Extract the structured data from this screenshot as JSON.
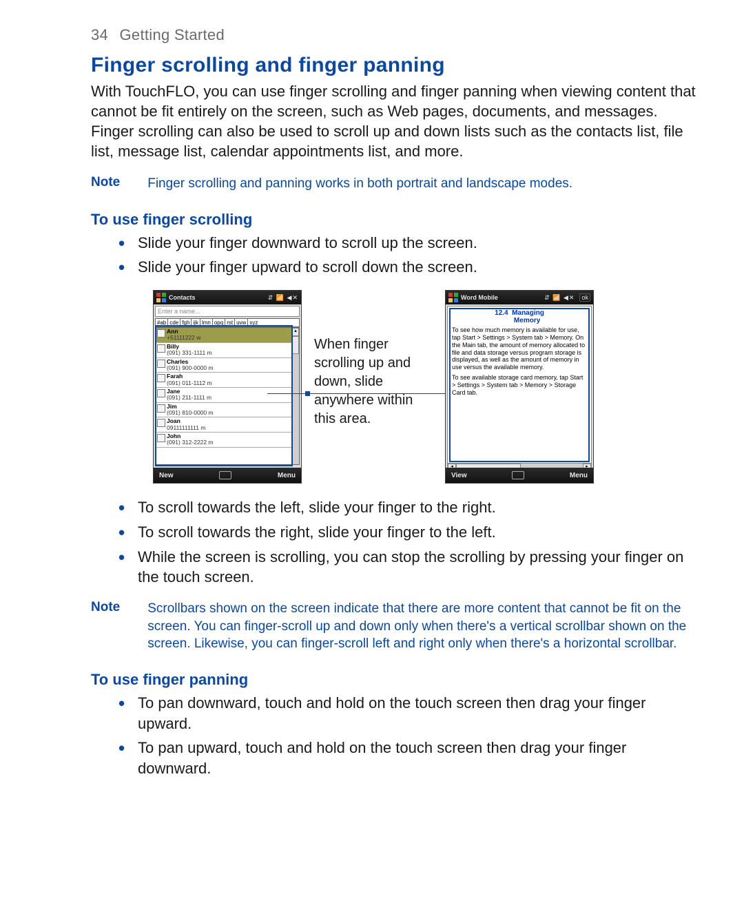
{
  "page": {
    "number": "34",
    "section": "Getting Started"
  },
  "heading1": "Finger scrolling and finger panning",
  "intro": "With TouchFLO, you can use finger scrolling and finger panning when viewing content that cannot be fit entirely on the screen, such as Web pages, documents, and messages. Finger scrolling can also be used to scroll up and down lists such as the contacts list, file list, message list, calendar appointments list, and more.",
  "note1": {
    "label": "Note",
    "text": "Finger scrolling and panning works in both portrait and landscape modes."
  },
  "sub1": "To use finger scrolling",
  "bullets1": [
    "Slide your finger downward to scroll up the screen.",
    "Slide your finger upward to scroll down the screen."
  ],
  "midCaption": "When finger scrolling up and down, slide anywhere within this area.",
  "bullets2": [
    "To scroll towards the left, slide your finger to the right.",
    "To scroll towards the right, slide your finger to the left.",
    "While the screen is scrolling, you can stop the scrolling by pressing your finger on the touch screen."
  ],
  "note2": {
    "label": "Note",
    "text": "Scrollbars shown on the screen indicate that there are more content that cannot be fit on the screen. You can finger-scroll up and down only when there's a vertical scrollbar shown on the screen. Likewise, you can finger-scroll left and right only when there's a horizontal scrollbar."
  },
  "sub2": "To use finger panning",
  "bullets3": [
    "To pan downward, touch and hold on the touch screen then drag your finger upward.",
    "To pan upward, touch and hold on the touch screen then drag your finger downward."
  ],
  "phone1": {
    "title": "Contacts",
    "statusIcons": "⇵  📶 ◀✕",
    "inputPlaceholder": "Enter a name...",
    "alphaTabs": [
      "#ab",
      "cde",
      "fgh",
      "ijk",
      "lmn",
      "opq",
      "rst",
      "uvw",
      "xyz"
    ],
    "contacts": [
      {
        "name": "Ann",
        "num": "+51111222  w",
        "selected": true
      },
      {
        "name": "Billy",
        "num": "(091) 331-1111  m"
      },
      {
        "name": "Charles",
        "num": "(091) 900-0000  m"
      },
      {
        "name": "Farah",
        "num": "(091) 011-1112  m"
      },
      {
        "name": "Jane",
        "num": "(091) 211-1111  m"
      },
      {
        "name": "Jim",
        "num": "(091) 810-0000  m"
      },
      {
        "name": "Joan",
        "num": "09111111111  m"
      },
      {
        "name": "John",
        "num": "(091) 312-2222  m"
      }
    ],
    "softLeft": "New",
    "softRight": "Menu"
  },
  "phone2": {
    "title": "Word Mobile",
    "statusIcons": "⇵  📶 ◀✕",
    "ok": "ok",
    "docTitle": "12.4  Managing\n        Memory",
    "docPara1": "To see how much memory is available for use, tap Start > Settings > System tab > Memory. On the Main tab, the amount of memory allocated to file and data storage versus program storage is displayed, as well as the amount of memory in use versus the available memory.",
    "docPara2": "To see available storage card memory, tap Start > Settings > System tab > Memory > Storage Card tab.",
    "softLeft": "View",
    "softRight": "Menu"
  }
}
